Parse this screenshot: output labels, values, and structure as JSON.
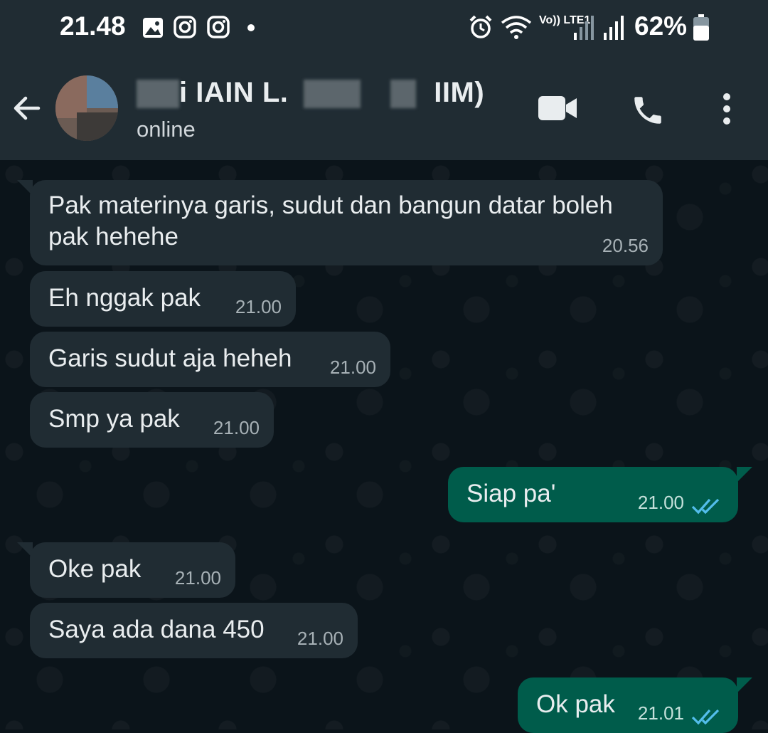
{
  "status_bar": {
    "time": "21.48",
    "network_label": "Vo)) LTE1",
    "battery": "62%"
  },
  "header": {
    "contact_name_visible": "i IAIN L.",
    "contact_name_tail": "IIM)",
    "status": "online"
  },
  "messages": [
    {
      "direction": "in",
      "text_line1": "Pak materinya garis, sudut dan bangun datar boleh",
      "text_line2": "pak hehehe",
      "time": "20.56"
    },
    {
      "direction": "in",
      "text": "Eh nggak pak",
      "time": "21.00"
    },
    {
      "direction": "in",
      "text": "Garis sudut aja heheh",
      "time": "21.00"
    },
    {
      "direction": "in",
      "text": "Smp ya pak",
      "time": "21.00"
    },
    {
      "direction": "out",
      "text": "Siap pa'",
      "time": "21.00",
      "status": "read"
    },
    {
      "direction": "in",
      "text": "Oke pak",
      "time": "21.00"
    },
    {
      "direction": "in",
      "text": "Saya ada dana 450",
      "time": "21.00"
    },
    {
      "direction": "out",
      "text": "Ok pak",
      "time": "21.01",
      "status": "read"
    }
  ],
  "colors": {
    "background": "#0b141a",
    "header": "#202c33",
    "incoming_bubble": "#202c33",
    "outgoing_bubble": "#005c4b",
    "read_ticks": "#53bdeb"
  },
  "icons": [
    "image-icon",
    "instagram-icon",
    "instagram-icon",
    "dot-icon",
    "alarm-icon",
    "wifi-icon",
    "signal-icon",
    "signal-icon",
    "battery-icon",
    "back-arrow-icon",
    "video-call-icon",
    "phone-icon",
    "more-options-icon",
    "double-check-icon"
  ]
}
